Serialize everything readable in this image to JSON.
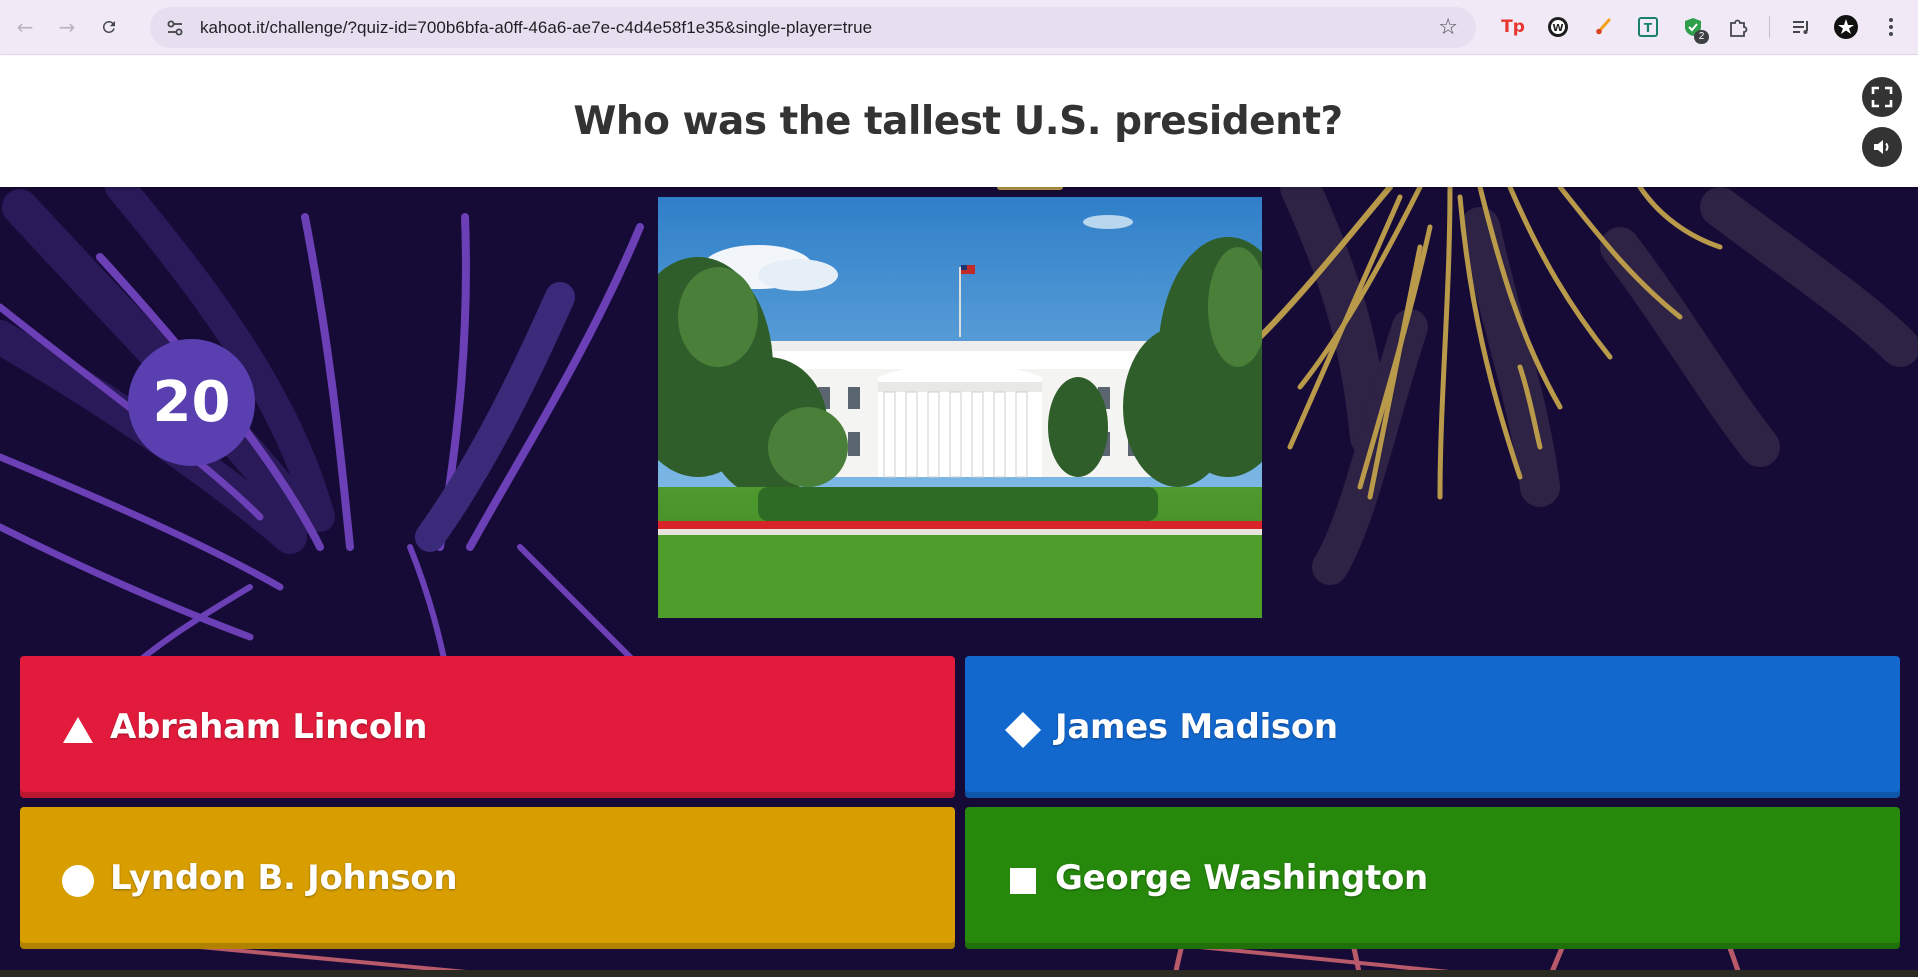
{
  "browser": {
    "url": "kahoot.it/challenge/?quiz-id=700b6bfa-a0ff-46a6-ae7e-c4d4e58f1e35&single-player=true",
    "tab_badge_count": "2"
  },
  "question": {
    "text": "Who was the tallest U.S. president?"
  },
  "timer": {
    "seconds": "20"
  },
  "answers": [
    {
      "label": "Abraham Lincoln",
      "shape": "triangle-icon",
      "color": "#e21b3c"
    },
    {
      "label": "James Madison",
      "shape": "diamond-icon",
      "color": "#1368ce"
    },
    {
      "label": "Lyndon B. Johnson",
      "shape": "circle-icon",
      "color": "#d89e00"
    },
    {
      "label": "George Washington",
      "shape": "square-icon",
      "color": "#26890c"
    }
  ],
  "theme": {
    "background": "#160b37",
    "timer_color": "#5a3fb0"
  }
}
